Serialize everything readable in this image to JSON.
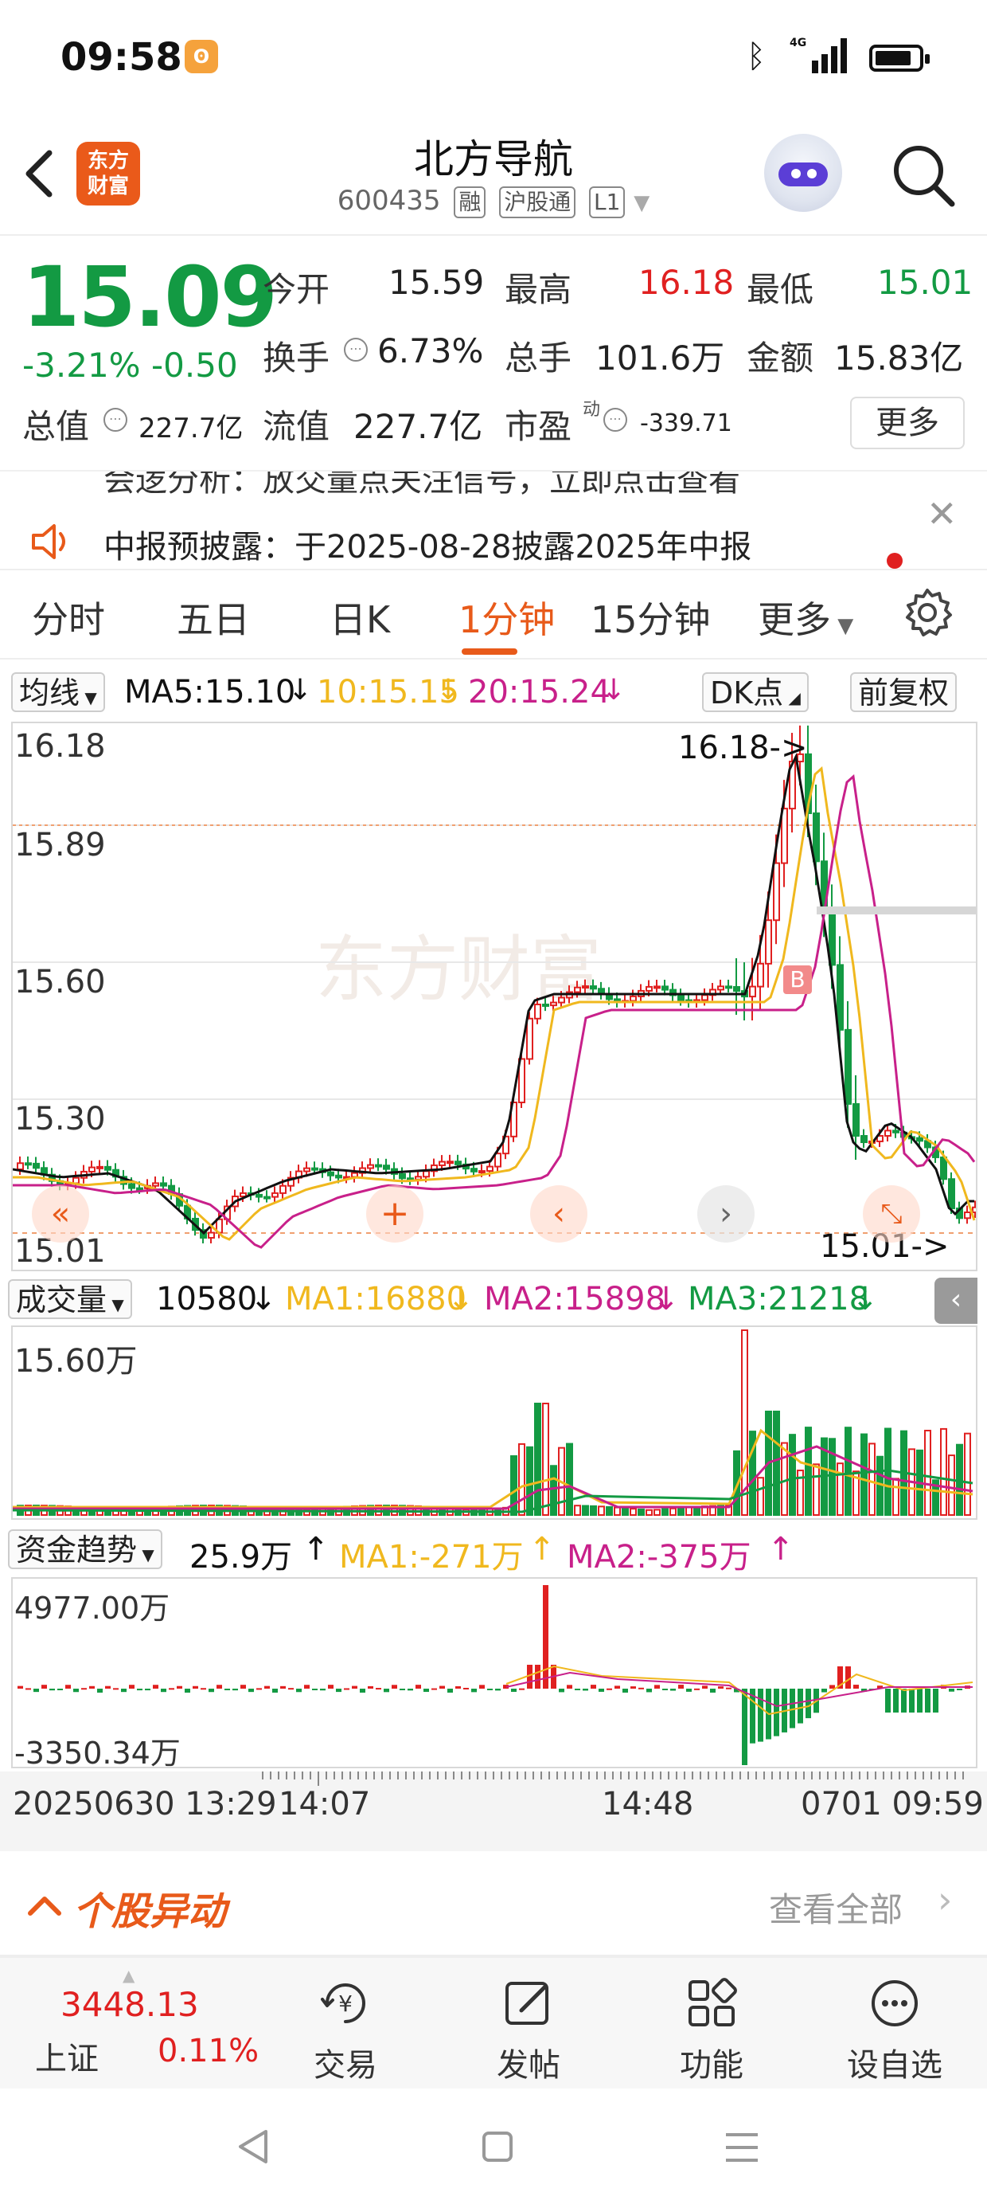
{
  "status": {
    "time": "09:58",
    "network": "4G"
  },
  "header": {
    "title": "北方导航",
    "code": "600435",
    "tags": [
      "融",
      "沪股通",
      "L1"
    ],
    "logo_text": "东方财富"
  },
  "quote": {
    "price": "15.09",
    "change_pct": "-3.21%",
    "change": "-0.50",
    "open_label": "今开",
    "open": "15.59",
    "high_label": "最高",
    "high": "16.18",
    "low_label": "最低",
    "low": "15.01",
    "turnover_label": "换手",
    "turnover": "6.73%",
    "volume_label": "总手",
    "volume": "101.6万",
    "amount_label": "金额",
    "amount": "15.83亿",
    "mktcap_label": "总值",
    "mktcap": "227.7亿",
    "float_label": "流值",
    "float": "227.7亿",
    "pe_label": "市盈",
    "pe_sup": "动",
    "pe": "-339.71",
    "more": "更多"
  },
  "notice": {
    "prev_text": "会逻分析：放交量点关注信号，立即点击查看",
    "text": "中报预披露：于2025-08-28披露2025年中报"
  },
  "tabs": [
    "分时",
    "五日",
    "日K",
    "1分钟",
    "15分钟",
    "更多"
  ],
  "active_tab": "1分钟",
  "ma_legend": {
    "selector": "均线",
    "ma5": "MA5:15.10",
    "ma10": "10:15.15",
    "ma20": "20:15.24",
    "dk": "DK点",
    "fq": "前复权"
  },
  "price_chart": {
    "y_labels": [
      "16.18",
      "15.89",
      "15.60",
      "15.30",
      "15.01"
    ],
    "max_note": "16.18->",
    "min_note": "15.01->",
    "watermark": "东方财富",
    "b_marker": "B"
  },
  "volume_legend": {
    "selector": "成交量",
    "value": "10580",
    "ma1": "MA1:16880",
    "ma2": "MA2:15898",
    "ma3": "MA3:21218"
  },
  "volume_chart": {
    "y_label": "15.60万"
  },
  "flow_legend": {
    "selector": "资金趋势",
    "value": "25.9万",
    "ma1": "MA1:-271万",
    "ma2": "MA2:-375万"
  },
  "flow_chart": {
    "y_top": "4977.00万",
    "y_bottom": "-3350.34万"
  },
  "time_axis": {
    "start": "20250630 13:29",
    "t1": "14:07",
    "t2": "14:48",
    "end": "0701 09:59"
  },
  "stock_move": {
    "title": "个股异动",
    "view_all": "查看全部"
  },
  "bottom_bar": {
    "index_value": "3448.13",
    "index_name": "上证",
    "index_change": "0.11%",
    "items": [
      "交易",
      "发帖",
      "功能",
      "设自选"
    ]
  },
  "colors": {
    "up": "#e02020",
    "down": "#139a43",
    "accent": "#e85a1a",
    "ma5": "#111111",
    "ma10": "#f0b81e",
    "ma20": "#c8208a"
  }
}
